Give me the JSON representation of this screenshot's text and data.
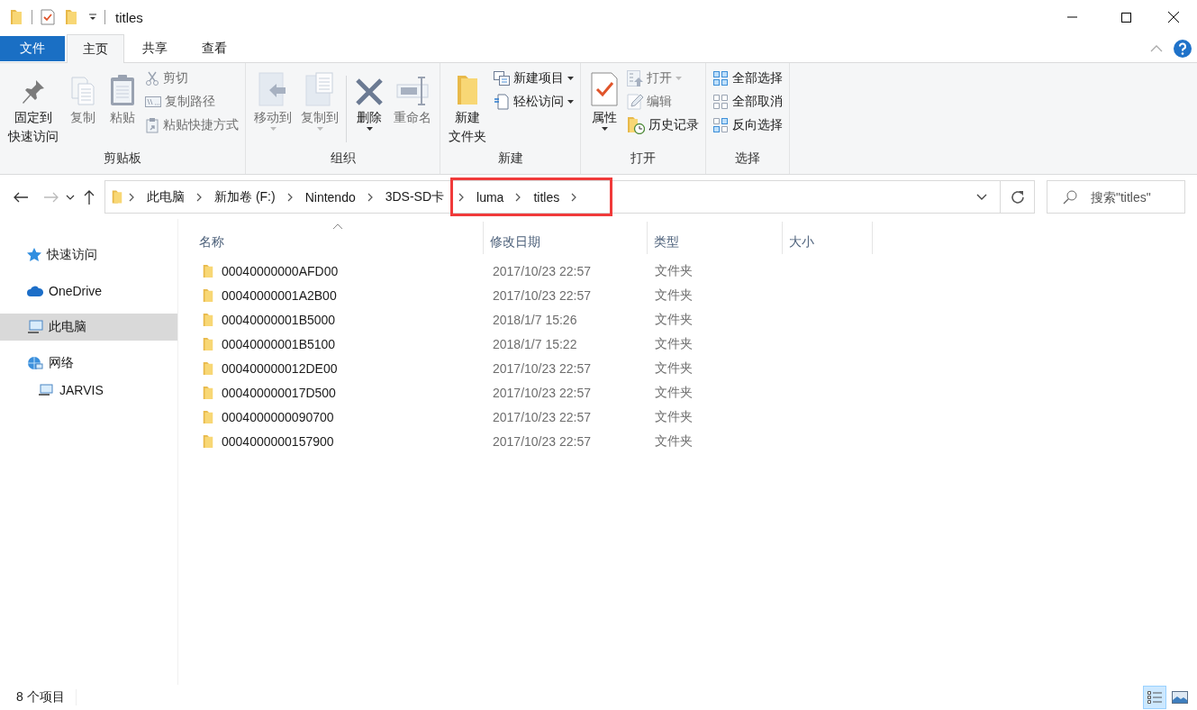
{
  "window": {
    "title": "titles"
  },
  "ribbon": {
    "tabs": [
      {
        "label": "文件",
        "kind": "file",
        "selected": false
      },
      {
        "label": "主页",
        "kind": "tab",
        "selected": true
      },
      {
        "label": "共享",
        "kind": "tab",
        "selected": false
      },
      {
        "label": "查看",
        "kind": "tab",
        "selected": false
      }
    ],
    "groups": [
      {
        "label": "剪贴板",
        "items": [
          {
            "kind": "large",
            "lines": [
              "固定到",
              "快速访问"
            ],
            "disabled": false,
            "menu": false
          },
          {
            "kind": "large",
            "lines": [
              "复制"
            ],
            "disabled": true,
            "menu": false
          },
          {
            "kind": "large",
            "lines": [
              "粘贴"
            ],
            "disabled": true,
            "menu": false
          },
          {
            "kind": "small",
            "label": "剪切",
            "disabled": true,
            "menu": false
          },
          {
            "kind": "small",
            "label": "复制路径",
            "disabled": true,
            "menu": false
          },
          {
            "kind": "small",
            "label": "粘贴快捷方式",
            "disabled": true,
            "menu": false
          }
        ]
      },
      {
        "label": "组织",
        "items": [
          {
            "kind": "large",
            "lines": [
              "移动到"
            ],
            "disabled": true,
            "menu": true
          },
          {
            "kind": "large",
            "lines": [
              "复制到"
            ],
            "disabled": true,
            "menu": true
          },
          {
            "kind": "separator"
          },
          {
            "kind": "large",
            "lines": [
              "删除"
            ],
            "disabled": false,
            "menu": true
          },
          {
            "kind": "large",
            "lines": [
              "重命名"
            ],
            "disabled": true,
            "menu": false
          }
        ]
      },
      {
        "label": "新建",
        "items": [
          {
            "kind": "large",
            "lines": [
              "新建",
              "文件夹"
            ],
            "disabled": false,
            "menu": false
          },
          {
            "kind": "small",
            "label": "新建项目",
            "disabled": false,
            "menu": true
          },
          {
            "kind": "small",
            "label": "轻松访问",
            "disabled": false,
            "menu": true
          }
        ]
      },
      {
        "label": "打开",
        "items": [
          {
            "kind": "large",
            "lines": [
              "属性"
            ],
            "disabled": false,
            "menu": true
          },
          {
            "kind": "small",
            "label": "打开",
            "disabled": true,
            "menu": true
          },
          {
            "kind": "small",
            "label": "编辑",
            "disabled": true,
            "menu": false
          },
          {
            "kind": "small",
            "label": "历史记录",
            "disabled": false,
            "menu": false
          }
        ]
      },
      {
        "label": "选择",
        "items": [
          {
            "kind": "small",
            "label": "全部选择",
            "disabled": false,
            "menu": false
          },
          {
            "kind": "small",
            "label": "全部取消",
            "disabled": false,
            "menu": false
          },
          {
            "kind": "small",
            "label": "反向选择",
            "disabled": false,
            "menu": false
          }
        ]
      }
    ]
  },
  "address": {
    "crumbs": [
      {
        "label": "此电脑",
        "highlighted": false
      },
      {
        "label": "新加卷 (F:)",
        "highlighted": false
      },
      {
        "label": "Nintendo",
        "highlighted": false
      },
      {
        "label": "3DS-SD卡",
        "highlighted": false
      },
      {
        "label": "luma",
        "highlighted": true
      },
      {
        "label": "titles",
        "highlighted": true
      }
    ],
    "search": {
      "placeholder": "搜索\"titles\""
    }
  },
  "navigation": {
    "items": [
      {
        "label": "快速访问",
        "selected": false
      },
      {
        "label": "OneDrive",
        "selected": false
      },
      {
        "label": "此电脑",
        "selected": true
      },
      {
        "label": "网络",
        "selected": false,
        "children": [
          {
            "label": "JARVIS",
            "selected": false
          }
        ]
      }
    ]
  },
  "table": {
    "columns": [
      {
        "label": "名称",
        "sorted": true
      },
      {
        "label": "修改日期",
        "sorted": false
      },
      {
        "label": "类型",
        "sorted": false
      },
      {
        "label": "大小",
        "sorted": false
      }
    ],
    "rows": [
      {
        "name": "00040000000AFD00",
        "modified": "2017/10/23 22:57",
        "type": "文件夹"
      },
      {
        "name": "00040000001A2B00",
        "modified": "2017/10/23 22:57",
        "type": "文件夹"
      },
      {
        "name": "00040000001B5000",
        "modified": "2018/1/7 15:26",
        "type": "文件夹"
      },
      {
        "name": "00040000001B5100",
        "modified": "2018/1/7 15:22",
        "type": "文件夹"
      },
      {
        "name": "000400000012DE00",
        "modified": "2017/10/23 22:57",
        "type": "文件夹"
      },
      {
        "name": "000400000017D500",
        "modified": "2017/10/23 22:57",
        "type": "文件夹"
      },
      {
        "name": "0004000000090700",
        "modified": "2017/10/23 22:57",
        "type": "文件夹"
      },
      {
        "name": "0004000000157900",
        "modified": "2017/10/23 22:57",
        "type": "文件夹"
      }
    ]
  },
  "status_bar": {
    "text": "8 个项目",
    "views": [
      {
        "kind": "details",
        "selected": true
      },
      {
        "kind": "large-icons",
        "selected": false
      }
    ]
  }
}
